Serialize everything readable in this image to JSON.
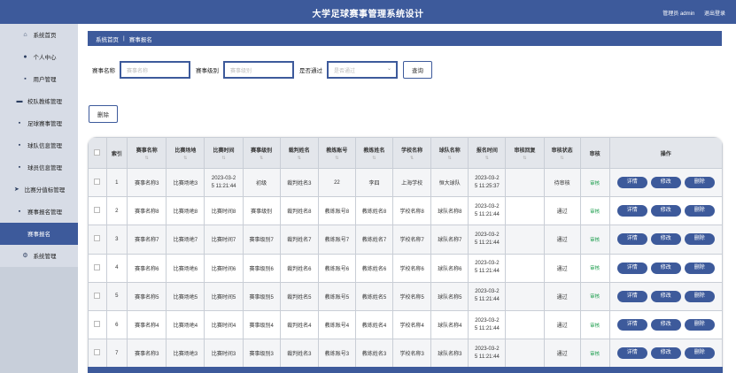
{
  "header": {
    "title": "大学足球赛事管理系统设计",
    "user_label": "管理员 admin",
    "logout": "退出登录"
  },
  "sidebar": {
    "items": [
      {
        "label": "系统首页",
        "icon": "home-icon",
        "glyph": "⌂"
      },
      {
        "label": "个人中心",
        "icon": "person-icon",
        "glyph": "●"
      },
      {
        "label": "用户管理",
        "icon": "grid-icon",
        "glyph": "▪"
      },
      {
        "label": "校队教练管理",
        "icon": "ticket-icon",
        "glyph": "▬"
      },
      {
        "label": "足球赛事管理",
        "icon": "grid-icon",
        "glyph": "▪"
      },
      {
        "label": "球队信息管理",
        "icon": "building-icon",
        "glyph": "▪"
      },
      {
        "label": "球员信息管理",
        "icon": "document-icon",
        "glyph": "▪"
      },
      {
        "label": "比赛分值标管理",
        "icon": "send-icon",
        "glyph": "➤"
      },
      {
        "label": "赛事报名管理",
        "icon": "grid-icon",
        "glyph": "▪"
      },
      {
        "label": "赛事报名",
        "icon": "",
        "glyph": ""
      },
      {
        "label": "系统管理",
        "icon": "gear-icon",
        "glyph": "⚙"
      }
    ],
    "active_index": 9
  },
  "breadcrumb": {
    "home": "系统首页",
    "separator": "|",
    "current": "赛事报名"
  },
  "search": {
    "name_label": "赛事名称",
    "name_placeholder": "赛事名称",
    "level_label": "赛事级别",
    "level_placeholder": "赛事级别",
    "pass_label": "是否通过",
    "pass_placeholder": "是否通过",
    "query_button": "查询"
  },
  "actions": {
    "delete_button": "删除"
  },
  "table": {
    "columns": [
      "索引",
      "赛事名称",
      "比赛场地",
      "比赛时间",
      "赛事级别",
      "裁判姓名",
      "教练账号",
      "教练姓名",
      "学校名称",
      "球队名称",
      "报名时间",
      "审核回复",
      "审核状态",
      "审核",
      "操作"
    ],
    "audit_label": "审核",
    "op_labels": [
      "详情",
      "修改",
      "删除"
    ],
    "rows": [
      [
        "1",
        "赛事名称3",
        "比赛场地3",
        "2023-03-2\n5 11:21:44",
        "初级",
        "裁判姓名3",
        "22",
        "李四",
        "上海学校",
        "恒大球队",
        "2023-03-2\n5 11:25:37",
        "",
        "待审核"
      ],
      [
        "2",
        "赛事名称8",
        "比赛场地8",
        "比赛时间8",
        "赛事级别",
        "裁判姓名8",
        "教练账号8",
        "教练姓名8",
        "学校名称8",
        "球队名称8",
        "2023-03-2\n5 11:21:44",
        "",
        "通过"
      ],
      [
        "3",
        "赛事名称7",
        "比赛场地7",
        "比赛时间7",
        "赛事级别7",
        "裁判姓名7",
        "教练账号7",
        "教练姓名7",
        "学校名称7",
        "球队名称7",
        "2023-03-2\n5 11:21:44",
        "",
        "通过"
      ],
      [
        "4",
        "赛事名称6",
        "比赛场地6",
        "比赛时间6",
        "赛事级别6",
        "裁判姓名6",
        "教练账号6",
        "教练姓名6",
        "学校名称6",
        "球队名称6",
        "2023-03-2\n5 11:21:44",
        "",
        "通过"
      ],
      [
        "5",
        "赛事名称5",
        "比赛场地5",
        "比赛时间5",
        "赛事级别5",
        "裁判姓名5",
        "教练账号5",
        "教练姓名5",
        "学校名称5",
        "球队名称5",
        "2023-03-2\n5 11:21:44",
        "",
        "通过"
      ],
      [
        "6",
        "赛事名称4",
        "比赛场地4",
        "比赛时间4",
        "赛事级别4",
        "裁判姓名4",
        "教练账号4",
        "教练姓名4",
        "学校名称4",
        "球队名称4",
        "2023-03-2\n5 11:21:44",
        "",
        "通过"
      ],
      [
        "7",
        "赛事名称3",
        "比赛场地3",
        "比赛时间3",
        "赛事级别3",
        "裁判姓名3",
        "教练账号3",
        "教练姓名3",
        "学校名称3",
        "球队名称3",
        "2023-03-2\n5 11:21:44",
        "",
        "通过"
      ]
    ]
  },
  "colors": {
    "primary": "#3d5a9b",
    "sidebar_bg": "#c8cfda",
    "audit_green": "#1a9c4b"
  }
}
